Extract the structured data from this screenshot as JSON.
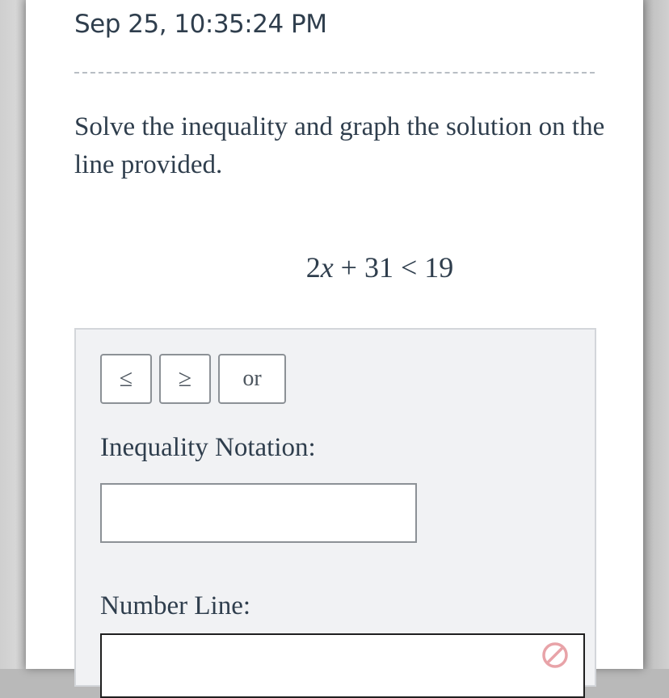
{
  "header": {
    "timestamp": "Sep 25, 10:35:24 PM"
  },
  "question": {
    "prompt": "Solve the inequality and graph the solution on the line provided.",
    "equation": {
      "coefficient": "2",
      "variable": "x",
      "plus": "+",
      "constant": "31",
      "relation": "<",
      "rhs": "19"
    }
  },
  "answer_panel": {
    "symbol_buttons": {
      "less_equal": "≤",
      "greater_equal": "≥",
      "or": "or"
    },
    "inequality_label": "Inequality Notation:",
    "inequality_value": "",
    "number_line_label": "Number Line:",
    "icons": {
      "clear": "clear-icon"
    }
  },
  "colors": {
    "text": "#2f3e4d",
    "panel_background": "#f1f2f4",
    "clear_icon": "#e8a3a8"
  }
}
